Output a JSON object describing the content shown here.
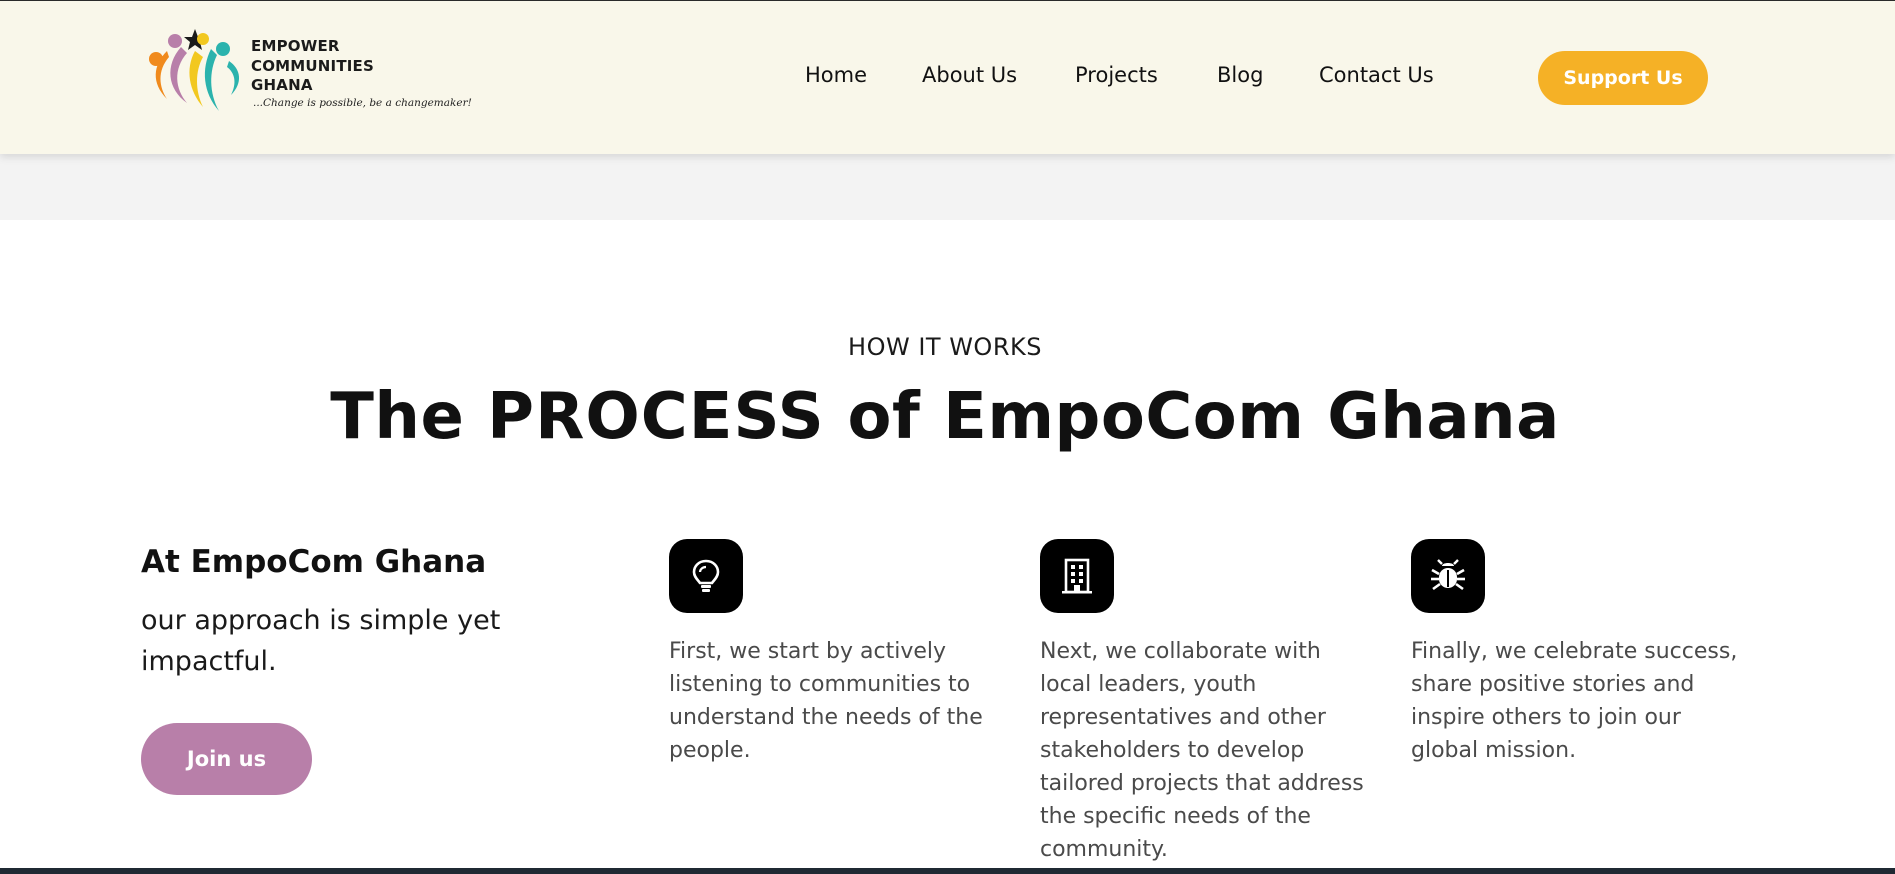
{
  "header": {
    "logo": {
      "lines": [
        "EMPOWER",
        "COMMUNITIES",
        "GHANA"
      ],
      "tagline": "...Change is possible, be a changemaker!",
      "colors": {
        "orange": "#f08a1c",
        "purple": "#b87fa9",
        "yellow": "#f2c81f",
        "teal": "#2bb3ad",
        "star": "#1a1a1a"
      }
    },
    "nav": [
      {
        "label": "Home"
      },
      {
        "label": "About Us"
      },
      {
        "label": "Projects"
      },
      {
        "label": "Blog"
      },
      {
        "label": "Contact Us"
      }
    ],
    "support_label": "Support Us"
  },
  "section": {
    "eyebrow": "HOW IT WORKS",
    "title_pre": "The ",
    "title_strong": "PROCESS",
    "title_post": " of EmpoCom Ghana"
  },
  "intro": {
    "heading": "At EmpoCom Ghana",
    "subtext": "our approach is simple yet impactful.",
    "join_label": "Join us"
  },
  "steps": [
    {
      "icon": "lightbulb-icon",
      "text": "First, we start by actively listening to communities to understand the needs of the people."
    },
    {
      "icon": "building-icon",
      "text": "Next, we collaborate with local leaders, youth representatives and other stakeholders to develop tailored projects that address the specific needs of the community."
    },
    {
      "icon": "bug-icon",
      "text": "Finally, we celebrate success, share positive stories and inspire others to join our global mission."
    }
  ],
  "colors": {
    "header_bg": "#f9f7ea",
    "support_button": "#f5b126",
    "join_button": "#b87fa9",
    "icon_tile": "#000000"
  }
}
